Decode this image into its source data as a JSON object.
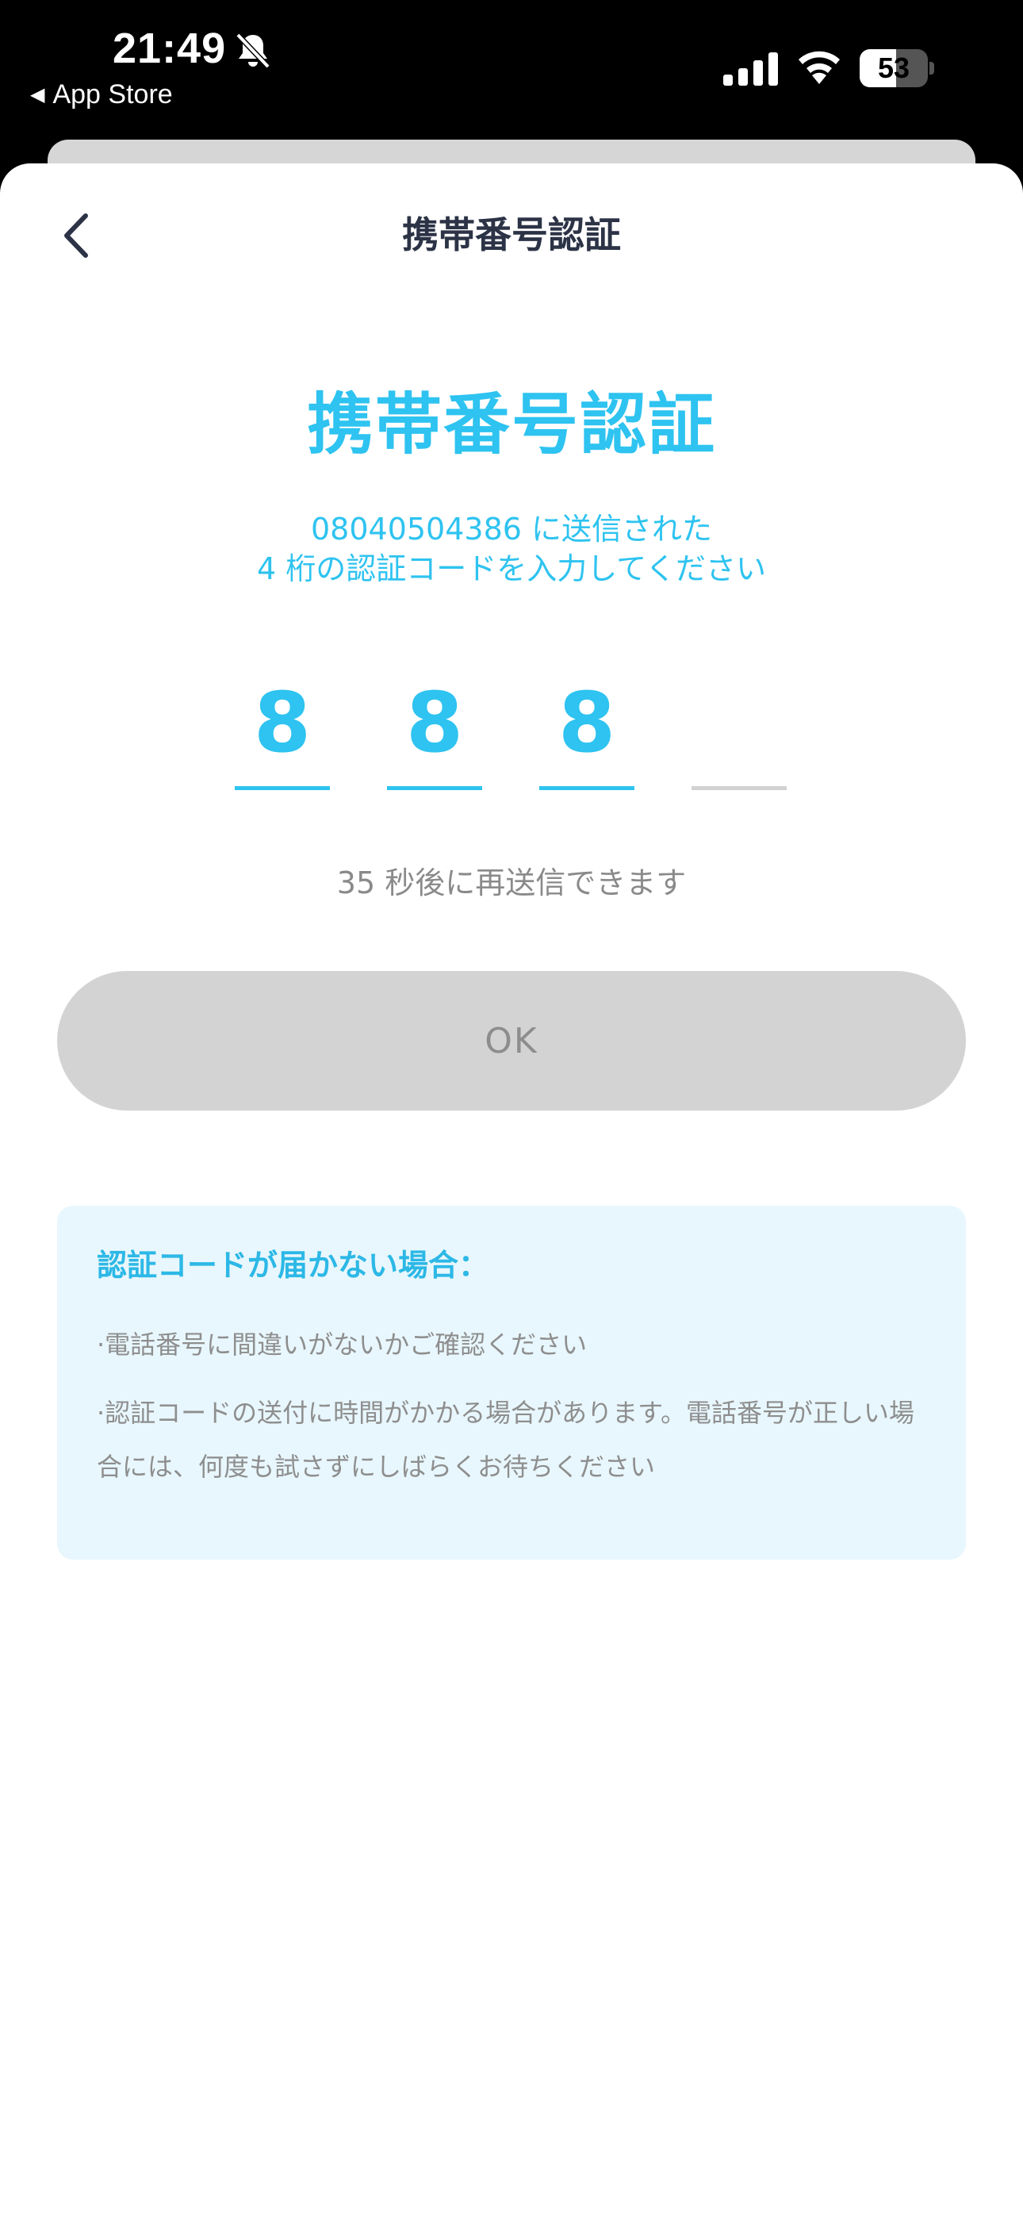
{
  "status_bar": {
    "time": "21:49",
    "back_app": "App Store",
    "battery": "53",
    "icons": [
      "bell-slash-icon",
      "cellular-signal-icon",
      "wifi-icon",
      "battery-icon"
    ]
  },
  "nav": {
    "title": "携帯番号認証",
    "back_icon": "chevron-left-icon"
  },
  "main": {
    "title": "携帯番号認証",
    "subtitle_line1": "08040504386 に送信された",
    "subtitle_line2": "4 桁の認証コードを入力してください",
    "code_digits": [
      "8",
      "8",
      "8",
      ""
    ],
    "resend_text": "35 秒後に再送信できます",
    "ok_label": "OK"
  },
  "help": {
    "title": "認証コードが届かない場合：",
    "items": [
      "·電話番号に間違いがないかご確認ください",
      "·認証コードの送付に時間がかかる場合があります。電話番号が正しい場合には、何度も試さずにしばらくお待ちください"
    ]
  },
  "colors": {
    "accent": "#2ec3f0",
    "nav_title": "#2c3346",
    "disabled_button": "#d3d3d3",
    "help_bg": "#e8f7fd"
  }
}
